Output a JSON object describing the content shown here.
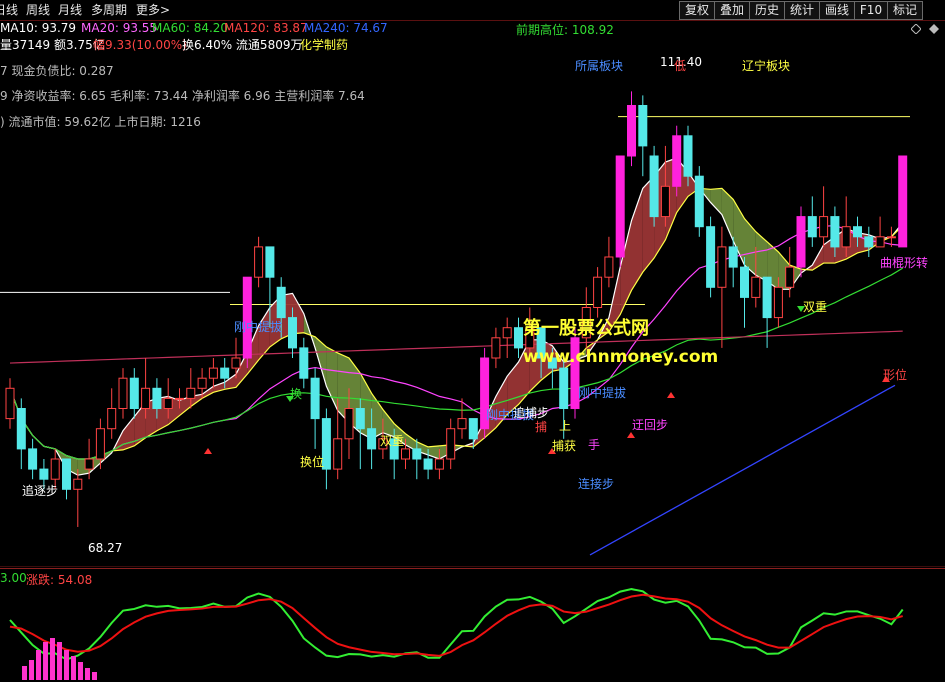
{
  "toolbar": {
    "periods": [
      "日线",
      "周线",
      "月线",
      "多周期",
      "更多>"
    ],
    "buttons": [
      "复权",
      "叠加",
      "历史",
      "统计",
      "画线",
      "F10",
      "标记"
    ],
    "icons": [
      "diamond-icon",
      "diamond-outline-icon"
    ]
  },
  "ma_line": [
    {
      "text": "MA10: 93.79",
      "color": "#ffffff"
    },
    {
      "text": "MA20: 93.55",
      "color": "#ff66ff"
    },
    {
      "text": "MA60: 84.20",
      "color": "#33dd33"
    },
    {
      "text": "MA120: 83.87",
      "color": "#ff4444"
    },
    {
      "text": "MA240: 74.67",
      "color": "#3366ff"
    }
  ],
  "prev_high": {
    "label": "前期高位: 108.92",
    "color": "#33dd33"
  },
  "info": {
    "line1_a": "量37149 额3.75亿",
    "line1_b": "幅9.33(10.00%)",
    "line1_c": "换6.40% 流通5809万",
    "line1_d": "化学制药",
    "line2": "7 现金负债比: 0.287",
    "line3": "9 净资收益率: 6.65 毛利率: 73.44 净利润率 6.96 主营利润率 7.64",
    "line4": ") 流通市值: 59.62亿 上市日期: 1216"
  },
  "annotations": {
    "sector": "所属板块",
    "region": "辽宁板块",
    "high_price": "111.40",
    "low_price": "68.27",
    "chase_step": "追逐步",
    "swap_pos": "换位",
    "double_heavy": "双重",
    "double_heavy2": "双重",
    "mid_pull": "刚中提拔",
    "mid_pull2": "刚中提拔",
    "mid_pull3": "刚中提拔",
    "chase_step2": "追捕步",
    "catch_step": "连接步",
    "return_step": "迂回步",
    "shape_pos": "形位",
    "stick_turn": "曲棍形转",
    "hand": "手",
    "grab": "捕获",
    "low_label": "低",
    "up_label": "上",
    "first_mark": "换",
    "ar": "捕"
  },
  "watermark": {
    "title": "第一股票公式网",
    "url": "www.chnmoney.com"
  },
  "sub_indicator": {
    "label_a": "3.00",
    "label_b": "涨跌: 54.08"
  },
  "chart_data": {
    "type": "candlestick",
    "candles": [
      {
        "o": 79,
        "c": 82,
        "h": 83,
        "l": 78
      },
      {
        "o": 80,
        "c": 76,
        "h": 81,
        "l": 74
      },
      {
        "o": 76,
        "c": 74,
        "h": 77,
        "l": 73
      },
      {
        "o": 74,
        "c": 73,
        "h": 75,
        "l": 72
      },
      {
        "o": 73,
        "c": 75,
        "h": 76,
        "l": 72
      },
      {
        "o": 75,
        "c": 72,
        "h": 75,
        "l": 71
      },
      {
        "o": 72,
        "c": 73,
        "h": 74,
        "l": 68.27
      },
      {
        "o": 74,
        "c": 75,
        "h": 77,
        "l": 73
      },
      {
        "o": 75,
        "c": 78,
        "h": 79,
        "l": 74
      },
      {
        "o": 78,
        "c": 80,
        "h": 82,
        "l": 77
      },
      {
        "o": 80,
        "c": 83,
        "h": 84,
        "l": 79
      },
      {
        "o": 83,
        "c": 80,
        "h": 84,
        "l": 79
      },
      {
        "o": 80,
        "c": 82,
        "h": 85,
        "l": 79
      },
      {
        "o": 82,
        "c": 80,
        "h": 83,
        "l": 79
      },
      {
        "o": 80,
        "c": 81,
        "h": 83,
        "l": 79
      },
      {
        "o": 81,
        "c": 81,
        "h": 82,
        "l": 80
      },
      {
        "o": 81,
        "c": 82,
        "h": 84,
        "l": 80
      },
      {
        "o": 82,
        "c": 83,
        "h": 84,
        "l": 81
      },
      {
        "o": 83,
        "c": 84,
        "h": 85,
        "l": 82
      },
      {
        "o": 84,
        "c": 83,
        "h": 85,
        "l": 82
      },
      {
        "o": 84,
        "c": 85,
        "h": 87,
        "l": 83
      },
      {
        "o": 85,
        "c": 93,
        "h": 93,
        "l": 84
      },
      {
        "o": 93,
        "c": 96,
        "h": 97,
        "l": 92
      },
      {
        "o": 96,
        "c": 93,
        "h": 96,
        "l": 88
      },
      {
        "o": 92,
        "c": 89,
        "h": 93,
        "l": 87
      },
      {
        "o": 89,
        "c": 86,
        "h": 90,
        "l": 85
      },
      {
        "o": 86,
        "c": 83,
        "h": 87,
        "l": 82
      },
      {
        "o": 83,
        "c": 79,
        "h": 84,
        "l": 76
      },
      {
        "o": 79,
        "c": 74,
        "h": 80,
        "l": 72
      },
      {
        "o": 74,
        "c": 77,
        "h": 81,
        "l": 73
      },
      {
        "o": 77,
        "c": 80,
        "h": 82,
        "l": 75
      },
      {
        "o": 80,
        "c": 78,
        "h": 81,
        "l": 74
      },
      {
        "o": 78,
        "c": 76,
        "h": 80,
        "l": 74
      },
      {
        "o": 76,
        "c": 77,
        "h": 79,
        "l": 75
      },
      {
        "o": 77,
        "c": 75,
        "h": 78,
        "l": 73
      },
      {
        "o": 75,
        "c": 76,
        "h": 77,
        "l": 74
      },
      {
        "o": 76,
        "c": 75,
        "h": 77,
        "l": 73
      },
      {
        "o": 75,
        "c": 74,
        "h": 76,
        "l": 73
      },
      {
        "o": 74,
        "c": 75,
        "h": 76,
        "l": 73
      },
      {
        "o": 75,
        "c": 78,
        "h": 79,
        "l": 74
      },
      {
        "o": 78,
        "c": 79,
        "h": 81,
        "l": 77
      },
      {
        "o": 79,
        "c": 77,
        "h": 79,
        "l": 76
      },
      {
        "o": 78,
        "c": 85,
        "h": 86,
        "l": 77
      },
      {
        "o": 85,
        "c": 87,
        "h": 88,
        "l": 84
      },
      {
        "o": 87,
        "c": 88,
        "h": 89,
        "l": 85
      },
      {
        "o": 88,
        "c": 86,
        "h": 89,
        "l": 85
      },
      {
        "o": 86,
        "c": 88,
        "h": 90,
        "l": 85
      },
      {
        "o": 88,
        "c": 85,
        "h": 88,
        "l": 83
      },
      {
        "o": 85,
        "c": 84,
        "h": 86,
        "l": 82
      },
      {
        "o": 84,
        "c": 80,
        "h": 85,
        "l": 77
      },
      {
        "o": 80,
        "c": 87,
        "h": 88,
        "l": 79
      },
      {
        "o": 87,
        "c": 90,
        "h": 92,
        "l": 86
      },
      {
        "o": 90,
        "c": 93,
        "h": 94,
        "l": 89
      },
      {
        "o": 93,
        "c": 95,
        "h": 97,
        "l": 92
      },
      {
        "o": 95,
        "c": 105,
        "h": 105,
        "l": 94
      },
      {
        "o": 105,
        "c": 110,
        "h": 111.4,
        "l": 104
      },
      {
        "o": 110,
        "c": 106,
        "h": 111,
        "l": 103
      },
      {
        "o": 105,
        "c": 99,
        "h": 106,
        "l": 98
      },
      {
        "o": 99,
        "c": 102,
        "h": 106,
        "l": 98
      },
      {
        "o": 102,
        "c": 107,
        "h": 108,
        "l": 101
      },
      {
        "o": 107,
        "c": 103,
        "h": 108,
        "l": 102
      },
      {
        "o": 103,
        "c": 98,
        "h": 104,
        "l": 97
      },
      {
        "o": 98,
        "c": 92,
        "h": 99,
        "l": 91
      },
      {
        "o": 92,
        "c": 96,
        "h": 98,
        "l": 86
      },
      {
        "o": 96,
        "c": 94,
        "h": 97,
        "l": 92
      },
      {
        "o": 94,
        "c": 91,
        "h": 95,
        "l": 88
      },
      {
        "o": 91,
        "c": 93,
        "h": 96,
        "l": 90
      },
      {
        "o": 93,
        "c": 89,
        "h": 93,
        "l": 86
      },
      {
        "o": 89,
        "c": 92,
        "h": 93,
        "l": 88
      },
      {
        "o": 92,
        "c": 94,
        "h": 96,
        "l": 91
      },
      {
        "o": 94,
        "c": 99,
        "h": 100,
        "l": 93
      },
      {
        "o": 99,
        "c": 97,
        "h": 101,
        "l": 96
      },
      {
        "o": 97,
        "c": 99,
        "h": 102,
        "l": 96
      },
      {
        "o": 99,
        "c": 96,
        "h": 100,
        "l": 95
      },
      {
        "o": 96,
        "c": 98,
        "h": 101,
        "l": 95
      },
      {
        "o": 98,
        "c": 97,
        "h": 99,
        "l": 96
      },
      {
        "o": 97,
        "c": 96,
        "h": 98,
        "l": 95
      },
      {
        "o": 96,
        "c": 97,
        "h": 99,
        "l": 96
      },
      {
        "o": 97,
        "c": 97,
        "h": 98,
        "l": 96
      },
      {
        "o": 96,
        "c": 105,
        "h": 105,
        "l": 96
      }
    ]
  }
}
